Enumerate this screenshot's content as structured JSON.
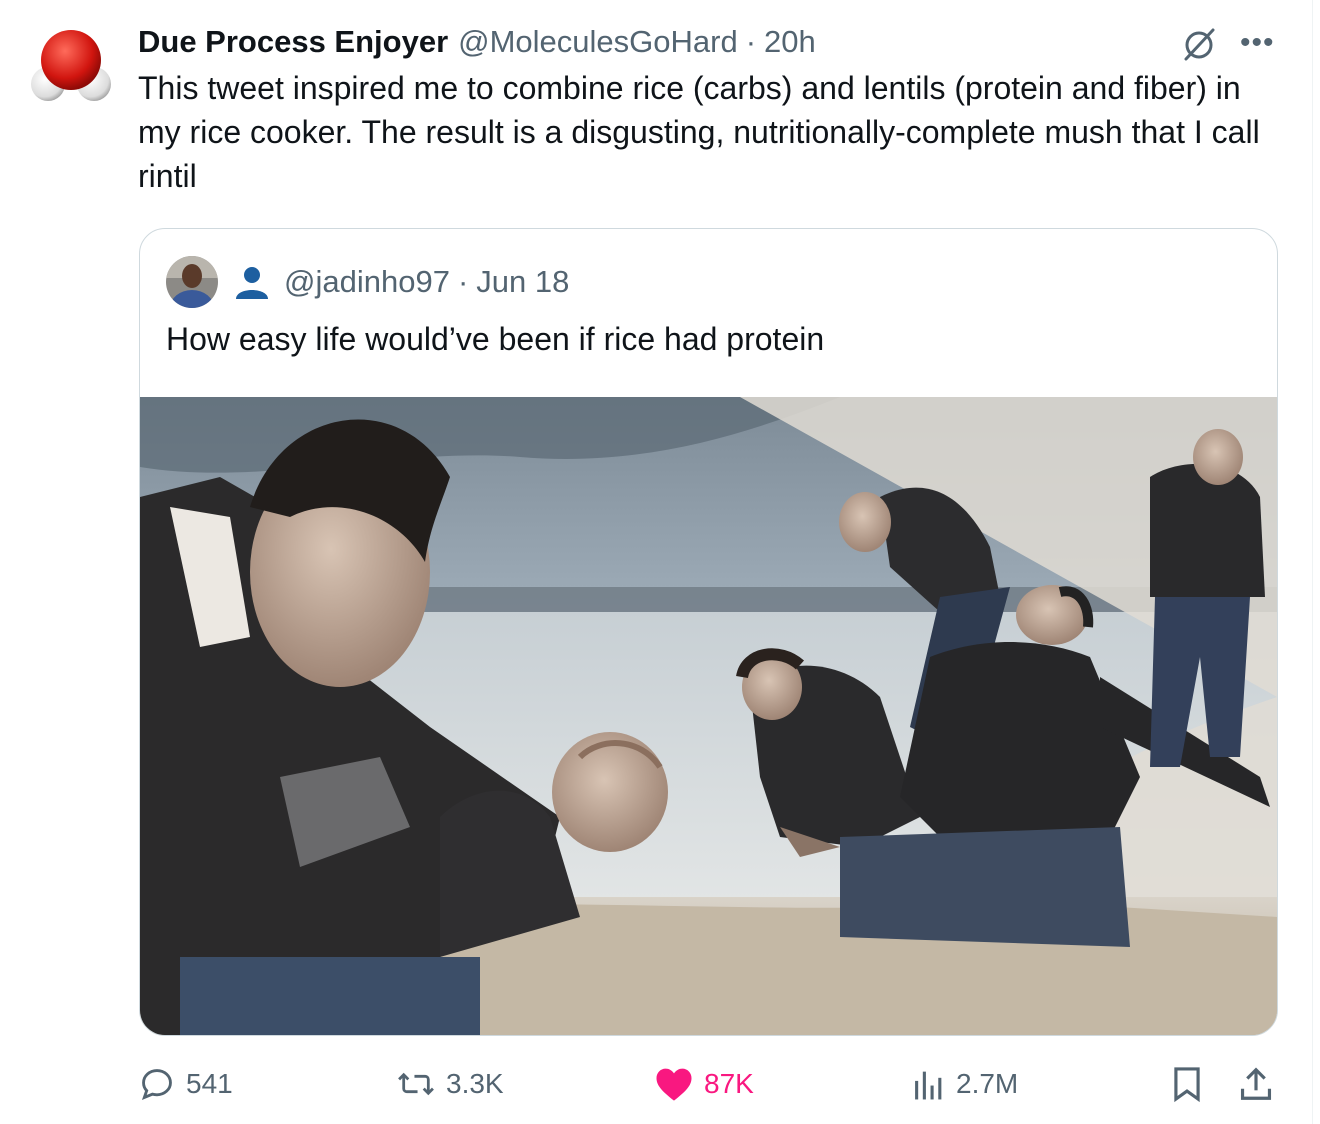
{
  "author": {
    "name": "Due Process Enjoyer",
    "handle": "@MoleculesGoHard",
    "separator": "·",
    "time": "20h",
    "avatar_icon": "water-molecule-icon"
  },
  "tweet": {
    "text": "This tweet inspired me to combine rice (carbs) and lentils (protein and fiber) in my rice cooker.  The result is a disgusting, nutritionally-complete mush that I call rintil"
  },
  "quoted": {
    "handle": "@jadinho97",
    "separator": "·",
    "date": "Jun 18",
    "text": "How easy life would’ve been if rice had protein",
    "image_icon": "beach-sand-meme-image"
  },
  "actions": {
    "replies": "541",
    "reposts": "3.3K",
    "likes": "87K",
    "views": "2.7M"
  },
  "colors": {
    "text": "#0f1419",
    "secondary": "#536471",
    "like": "#f91880",
    "border": "#cfd9de"
  }
}
